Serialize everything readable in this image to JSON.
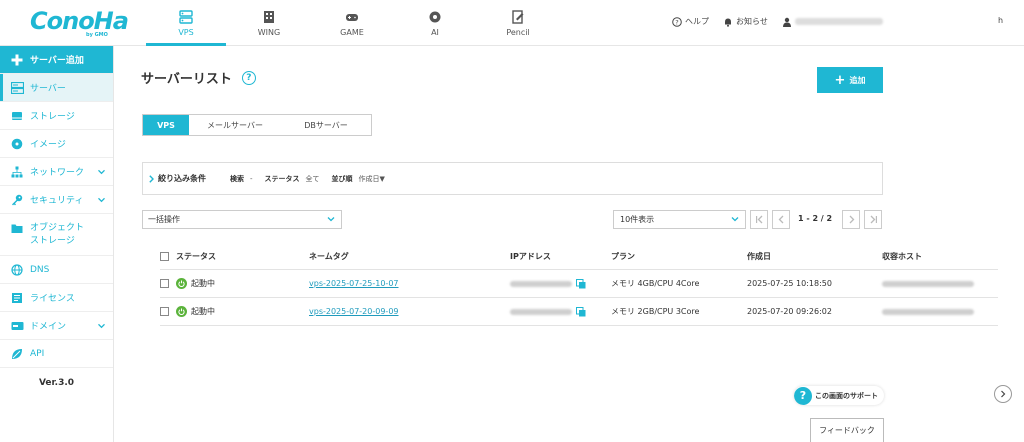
{
  "brand": {
    "logo_text": "ConoHa",
    "logo_sub": "by GMO",
    "accent": "#1fb7d3"
  },
  "nav": [
    {
      "label": "VPS",
      "icon": "server-stack-icon",
      "active": true
    },
    {
      "label": "WING",
      "icon": "building-icon",
      "active": false
    },
    {
      "label": "GAME",
      "icon": "gamepad-icon",
      "active": false
    },
    {
      "label": "AI",
      "icon": "ai-chip-icon",
      "active": false
    },
    {
      "label": "Pencil",
      "icon": "pencil-doc-icon",
      "active": false
    }
  ],
  "header": {
    "help": "ヘルプ",
    "notifications": "お知らせ",
    "cut_text": "h"
  },
  "sidebar": {
    "items": [
      {
        "label": "サーバー追加",
        "icon": "plus-icon"
      },
      {
        "label": "サーバー",
        "icon": "server-icon"
      },
      {
        "label": "ストレージ",
        "icon": "storage-icon"
      },
      {
        "label": "イメージ",
        "icon": "image-disc-icon"
      },
      {
        "label": "ネットワーク",
        "icon": "network-icon"
      },
      {
        "label": "セキュリティ",
        "icon": "key-icon"
      },
      {
        "label": "オブジェクト",
        "label2": "ストレージ",
        "icon": "folder-icon"
      },
      {
        "label": "DNS",
        "icon": "globe-icon"
      },
      {
        "label": "ライセンス",
        "icon": "license-icon"
      },
      {
        "label": "ドメイン",
        "icon": "domain-icon"
      },
      {
        "label": "API",
        "icon": "api-leaf-icon"
      }
    ],
    "version": "Ver.3.0"
  },
  "main": {
    "title": "サーバーリスト",
    "add_label": "追加",
    "tabs": [
      "VPS",
      "メールサーバー",
      "DBサーバー"
    ],
    "filter": {
      "title": "絞り込み条件",
      "search_label": "検索",
      "search_value": "-",
      "status_label": "ステータス",
      "status_value": "全て",
      "sort_label": "並び順",
      "sort_value": "作成日▼"
    },
    "bulk_label": "一括操作",
    "per_page": "10件表示",
    "page_info": "1 - 2 / 2",
    "table": {
      "headers": [
        "ステータス",
        "ネームタグ",
        "IPアドレス",
        "プラン",
        "作成日",
        "収容ホスト"
      ],
      "rows": [
        {
          "status": "起動中",
          "name": "vps-2025-07-25-10-07",
          "plan": "メモリ 4GB/CPU 4Core",
          "created": "2025-07-25 10:18:50"
        },
        {
          "status": "起動中",
          "name": "vps-2025-07-20-09-09",
          "plan": "メモリ 2GB/CPU 3Core",
          "created": "2025-07-20 09:26:02"
        }
      ]
    }
  },
  "support": {
    "label": "この画面のサポート",
    "feedback": "フィードバック"
  }
}
